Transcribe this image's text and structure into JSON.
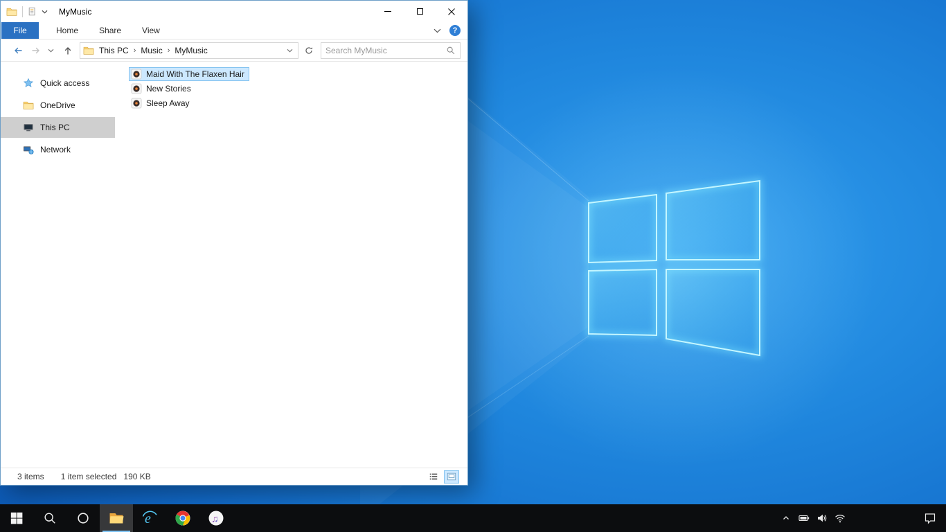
{
  "explorer": {
    "title": "MyMusic",
    "ribbon_tabs": [
      {
        "label": "File"
      },
      {
        "label": "Home"
      },
      {
        "label": "Share"
      },
      {
        "label": "View"
      }
    ],
    "breadcrumb": {
      "items": [
        "This PC",
        "Music",
        "MyMusic"
      ]
    },
    "search": {
      "placeholder": "Search MyMusic"
    },
    "sidebar": {
      "items": [
        {
          "label": "Quick access",
          "icon": "quick-access-star"
        },
        {
          "label": "OneDrive",
          "icon": "onedrive-folder"
        },
        {
          "label": "This PC",
          "icon": "this-pc-monitor",
          "selected": true
        },
        {
          "label": "Network",
          "icon": "network-computer"
        }
      ]
    },
    "files": [
      {
        "name": "Maid With The Flaxen Hair",
        "icon": "audio-file",
        "selected": true
      },
      {
        "name": "New Stories",
        "icon": "audio-file",
        "selected": false
      },
      {
        "name": "Sleep Away",
        "icon": "audio-file",
        "selected": false
      }
    ],
    "statusbar": {
      "item_count": "3 items",
      "selection": "1 item selected",
      "size": "190 KB"
    }
  },
  "glyphs": {
    "help": "?",
    "breadcrumb_separator": "›",
    "ie": "e",
    "itunes_note": "♫"
  },
  "taskbar": {
    "buttons": [
      "start",
      "search",
      "cortana",
      "file-explorer",
      "internet-explorer",
      "chrome",
      "itunes"
    ],
    "tray": [
      "tray-expand",
      "battery",
      "volume",
      "network",
      "action-center"
    ],
    "active_button": "file-explorer"
  },
  "colors": {
    "file_tab_blue": "#2b71c2",
    "selection_bg": "#cce8ff",
    "selection_border": "#84c3f0",
    "sidebar_selected_bg": "#cfcfcf",
    "taskbar_bg": "#0c0d0f",
    "desktop_blue": "#1a7ed8"
  }
}
